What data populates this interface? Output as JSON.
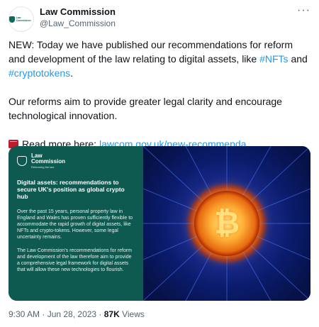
{
  "account": {
    "name": "Law Commission",
    "handle": "@Law_Commission",
    "avatar_text": "Law Commission"
  },
  "tweet": {
    "line1_pre": "NEW: Today we have published our recommendations for reform and development of the law relating to digital assets, like ",
    "hashtag1": "#NFTs",
    "line1_mid": " and ",
    "hashtag2": "#cryptotokens",
    "line1_end": ".",
    "para2": "Our reforms aim to provide greater legal clarity and encourage technological innovation.",
    "read_more_label": "Read more here: ",
    "link": "lawcom.gov.uk/new-recommenda…"
  },
  "card": {
    "logo_line1": "Law",
    "logo_line2": "Commission",
    "logo_tagline": "Reforming the law",
    "headline": "Digital assets: recommendations to secure UK's position as global crypto hub",
    "para1": "Over the past 15 years, personal property law in England and Wales has proven sufficiently flexible to accommodate the rapid growth of digital assets, like NFTs and crypto-tokens. However, some legal uncertainty remains.",
    "para2": "The Law Commission's recommendations for reform and development of the law therefore aim to provide a comprehensive legal framework for digital assets that will allow these new technologies to flourish.",
    "coin_symbol": "₿"
  },
  "meta": {
    "time_date": "9:30 AM · Jun 28, 2023 · ",
    "views_count": "87K",
    "views_label": " Views"
  },
  "icons": {
    "more": "more-options-icon",
    "read_more": "book-icon"
  },
  "colors": {
    "link": "#1d9bf0",
    "card_bg": "#0e5a50",
    "text_secondary": "#536471"
  }
}
